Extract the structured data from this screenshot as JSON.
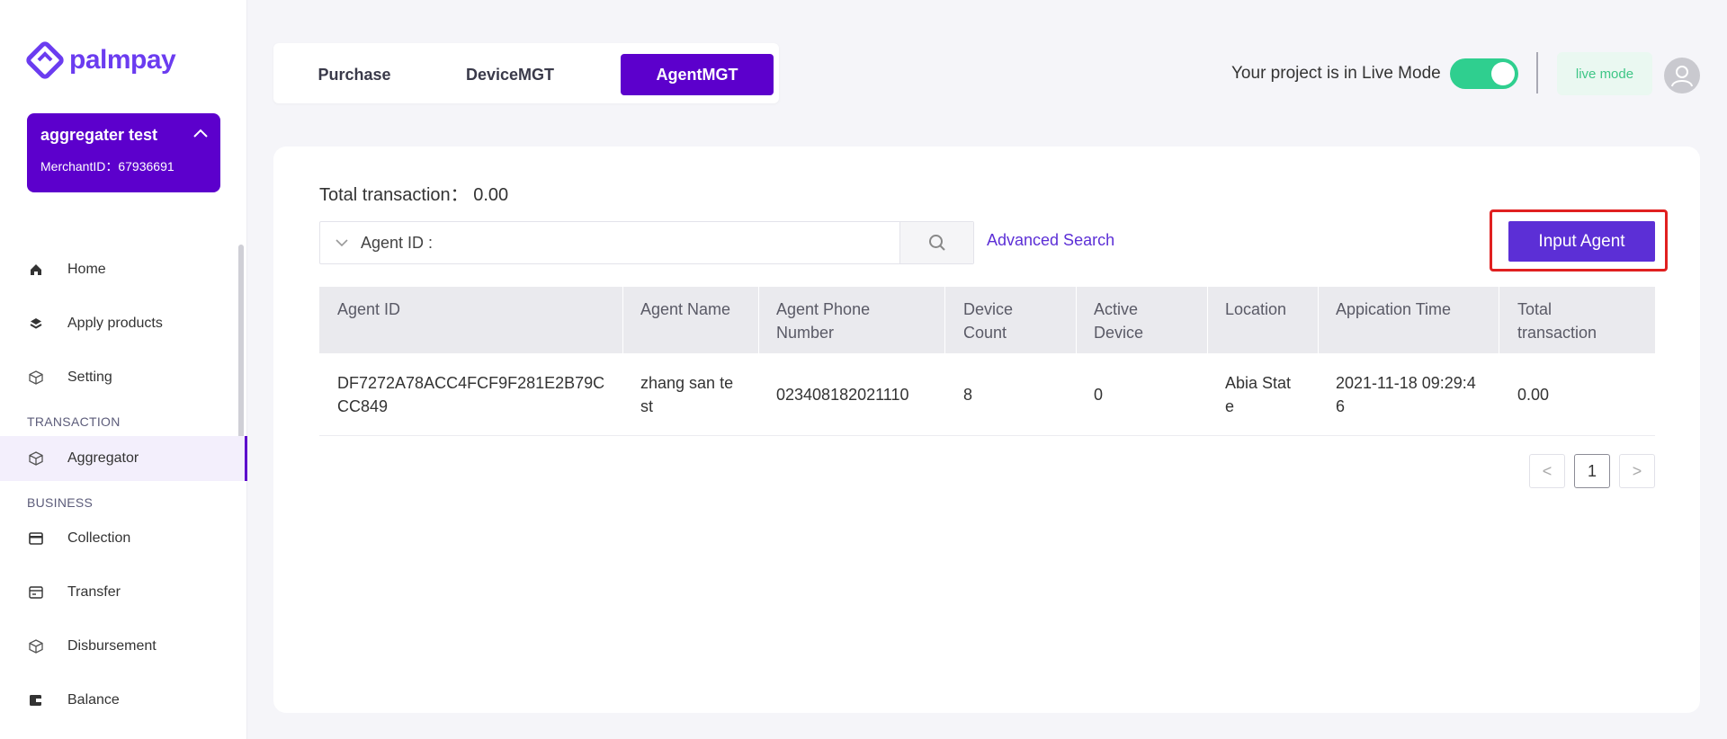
{
  "brand": {
    "name": "palmpay",
    "color": "#6b3cf0"
  },
  "merchant": {
    "name": "aggregater test",
    "id_label": "MerchantID：67936691"
  },
  "sidebar": {
    "items": [
      {
        "label": "Home",
        "icon": "home-icon"
      },
      {
        "label": "Apply products",
        "icon": "layers-icon"
      },
      {
        "label": "Setting",
        "icon": "cube-icon"
      },
      {
        "label": "Aggregator",
        "icon": "cube-icon",
        "active": true
      },
      {
        "label": "Collection",
        "icon": "card-icon"
      },
      {
        "label": "Transfer",
        "icon": "transfer-icon"
      },
      {
        "label": "Disbursement",
        "icon": "cube-icon"
      },
      {
        "label": "Balance",
        "icon": "wallet-icon"
      }
    ],
    "sections": {
      "transaction": "TRANSACTION",
      "business": "BUSINESS"
    }
  },
  "tabs": [
    {
      "label": "Purchase"
    },
    {
      "label": "DeviceMGT"
    },
    {
      "label": "AgentMGT",
      "active": true
    }
  ],
  "header": {
    "live_text": "Your project is in Live Mode",
    "live_toggle_on": true,
    "mode_badge": "live mode"
  },
  "main": {
    "total_label": "Total transaction： 0.00",
    "search": {
      "field_label": "Agent ID :"
    },
    "advanced_search": "Advanced Search",
    "input_agent": "Input Agent",
    "table": {
      "headers": [
        "Agent ID",
        "Agent Name",
        "Agent Phone Number",
        "Device Count",
        "Active Device",
        "Location",
        "Appication Time",
        "Total transaction"
      ],
      "rows": [
        {
          "agent_id": "DF7272A78ACC4FCF9F281E2B79CCC849",
          "agent_name": "zhang san test",
          "phone": "023408182021110",
          "device_count": "8",
          "active_device": "0",
          "location": "Abia State",
          "app_time": "2021-11-18 09:29:46",
          "total": "0.00"
        }
      ]
    },
    "pagination": {
      "current_page": "1",
      "prev": "<",
      "next": ">"
    }
  },
  "colors": {
    "primary": "#5c00cc",
    "accent": "#5c2fd6",
    "toggle_on": "#2fcf8f",
    "highlight": "#e02020"
  }
}
